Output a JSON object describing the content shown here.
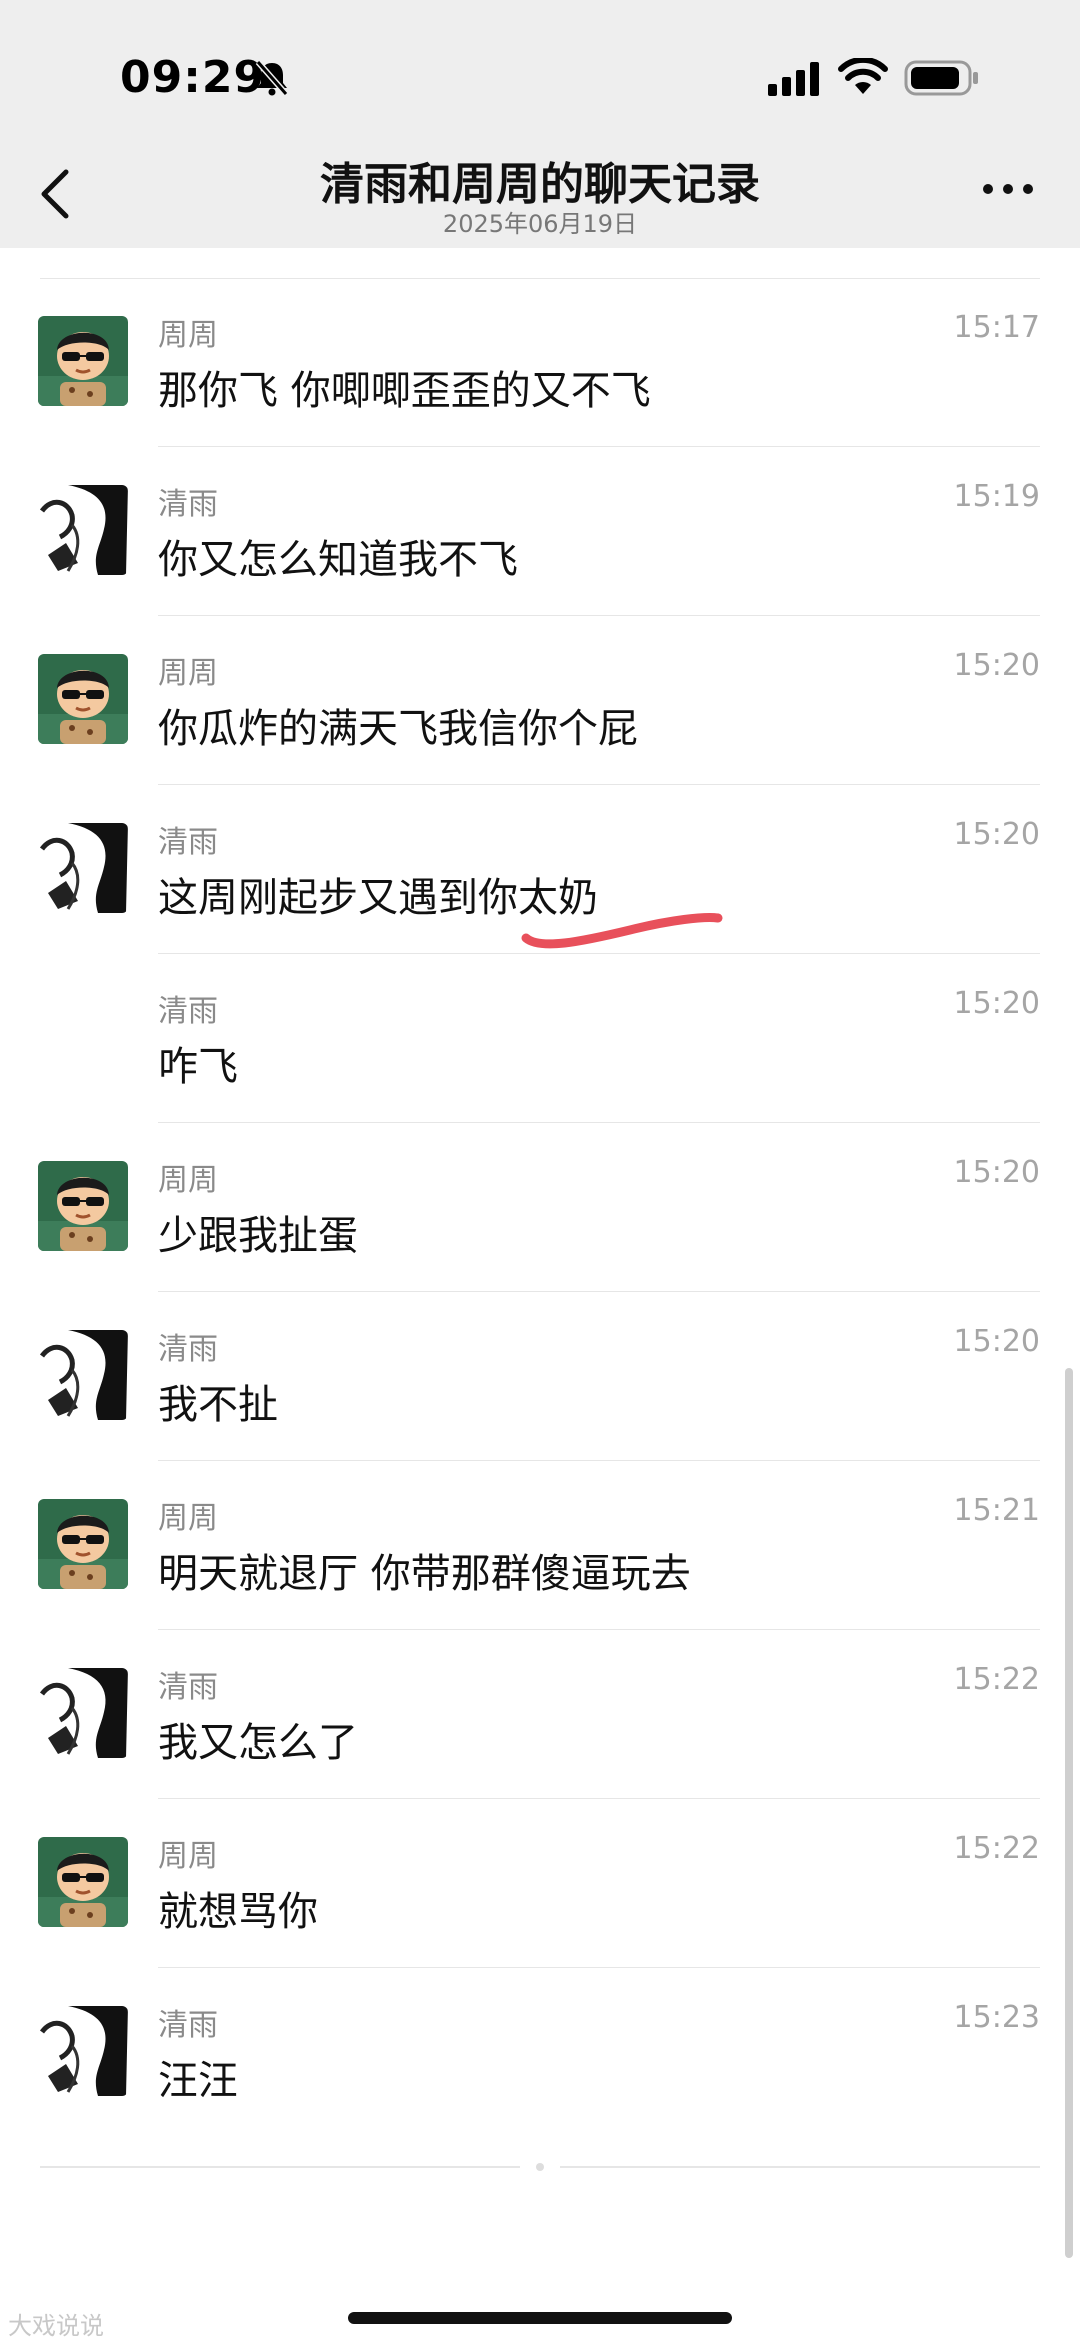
{
  "status_bar": {
    "time": "09:29"
  },
  "header": {
    "title": "清雨和周周的聊天记录",
    "subtitle": "2025年06月19日"
  },
  "messages": [
    {
      "sender": "周周",
      "text": "那你飞 你唧唧歪歪的又不飞",
      "time": "15:17",
      "avatar": "cartoon-boy"
    },
    {
      "sender": "清雨",
      "text": "你又怎么知道我不飞",
      "time": "15:19",
      "avatar": "mono-girl"
    },
    {
      "sender": "周周",
      "text": "你瓜炸的满天飞我信你个屁",
      "time": "15:20",
      "avatar": "cartoon-boy"
    },
    {
      "sender": "清雨",
      "text": "这周刚起步又遇到你太奶",
      "time": "15:20",
      "avatar": "mono-girl"
    },
    {
      "sender": "清雨",
      "text": "咋飞",
      "time": "15:20",
      "avatar": ""
    },
    {
      "sender": "周周",
      "text": "少跟我扯蛋",
      "time": "15:20",
      "avatar": "cartoon-boy"
    },
    {
      "sender": "清雨",
      "text": "我不扯",
      "time": "15:20",
      "avatar": "mono-girl"
    },
    {
      "sender": "周周",
      "text": "明天就退厅 你带那群傻逼玩去",
      "time": "15:21",
      "avatar": "cartoon-boy"
    },
    {
      "sender": "清雨",
      "text": "我又怎么了",
      "time": "15:22",
      "avatar": "mono-girl"
    },
    {
      "sender": "周周",
      "text": "就想骂你",
      "time": "15:22",
      "avatar": "cartoon-boy"
    },
    {
      "sender": "清雨",
      "text": "汪汪",
      "time": "15:23",
      "avatar": "mono-girl"
    }
  ],
  "watermark": "大戏说说",
  "colors": {
    "bar_bg": "#eeeeee",
    "underline": "#e8505b",
    "divider": "#e6e6e6"
  }
}
